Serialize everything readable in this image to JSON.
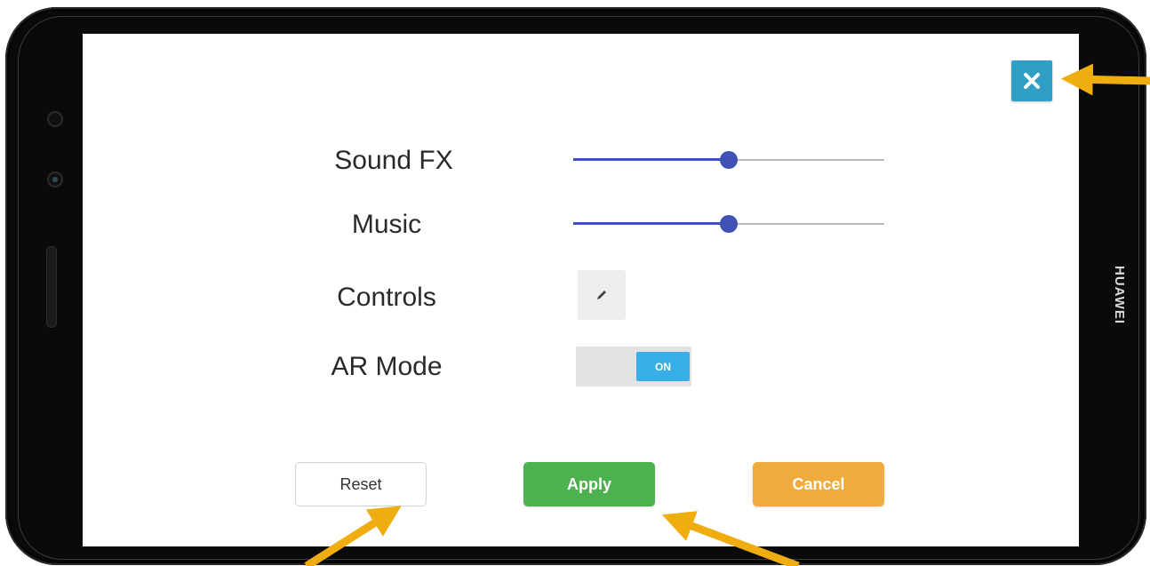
{
  "device": {
    "brand": "HUAWEI"
  },
  "settings": {
    "rows": [
      {
        "label": "Sound FX",
        "type": "slider",
        "value_fraction": 0.5
      },
      {
        "label": "Music",
        "type": "slider",
        "value_fraction": 0.5
      },
      {
        "label": "Controls",
        "type": "edit-button",
        "icon": "pencil-icon"
      },
      {
        "label": "AR Mode",
        "type": "toggle",
        "state": "ON"
      }
    ],
    "close_icon": "close-icon"
  },
  "buttons": {
    "reset": "Reset",
    "apply": "Apply",
    "cancel": "Cancel"
  },
  "colors": {
    "close_bg": "#2fa0c4",
    "slider_accent": "#3f51b5",
    "toggle_on": "#39aee6",
    "apply": "#4cb14e",
    "cancel": "#efab3d",
    "annotation_arrow": "#f0ad10"
  },
  "annotations": {
    "arrows": [
      "close-button",
      "reset-button",
      "apply-button"
    ]
  }
}
